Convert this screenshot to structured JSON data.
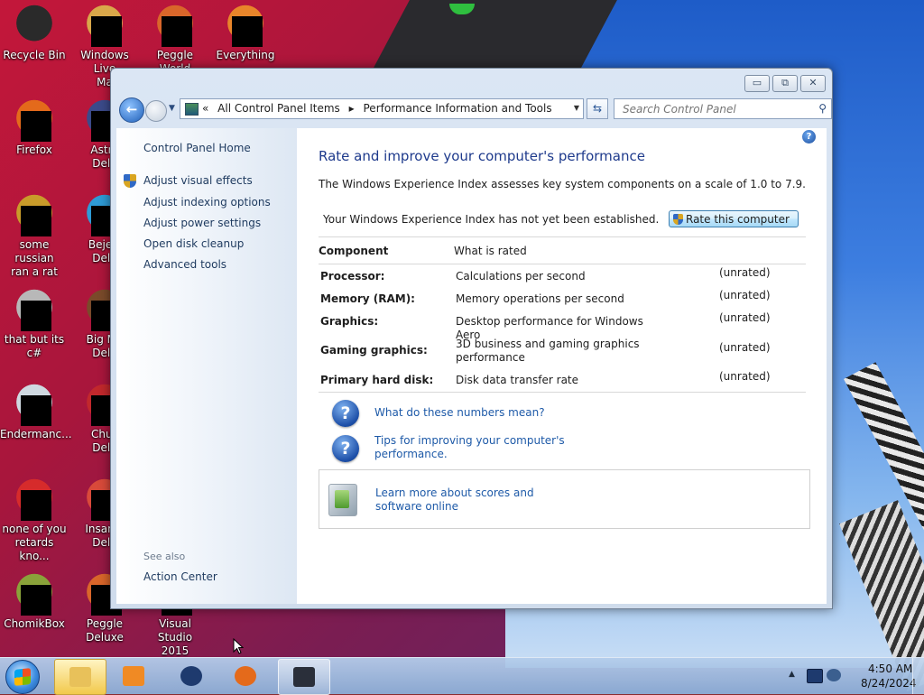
{
  "desktop": {
    "icons": [
      {
        "label": "Recycle Bin",
        "icon": "recycle-bin-icon",
        "color": "#2a2a2a"
      },
      {
        "label": "Windows Live\nMa",
        "icon": "windows-live-icon",
        "color": "#d9a74a"
      },
      {
        "label": "Peggle World",
        "icon": "peggle-world-icon",
        "color": "#d9662a"
      },
      {
        "label": "Everything",
        "icon": "everything-icon",
        "color": "#e8852a"
      },
      {
        "label": "Firefox",
        "icon": "firefox-icon",
        "color": "#e46a1b"
      },
      {
        "label": "Astro\nDelu",
        "icon": "astro-icon",
        "color": "#3b4a8a"
      },
      {
        "label": "some russian\nran a rat",
        "icon": "file-icon",
        "color": "#c99b2a"
      },
      {
        "label": "Bejew\nDelu",
        "icon": "bejeweled-icon",
        "color": "#2e9bd6"
      },
      {
        "label": "that but its c#",
        "icon": "file-icon",
        "color": "#b8b8b8"
      },
      {
        "label": "Big Mo\nDelu",
        "icon": "game-icon",
        "color": "#7a4a2a"
      },
      {
        "label": "Endermanc...",
        "icon": "app-icon",
        "color": "#cfd8e0"
      },
      {
        "label": "Chuz\nDelu",
        "icon": "chuzzle-icon",
        "color": "#c2282c"
      },
      {
        "label": "none of you\nretards kno...",
        "icon": "opera-icon",
        "color": "#d62b2b"
      },
      {
        "label": "Insaniq\nDelu",
        "icon": "game-icon",
        "color": "#d94a3a"
      },
      {
        "label": "ChomikBox",
        "icon": "chomikbox-icon",
        "color": "#8aa23a"
      },
      {
        "label": "Peggle Deluxe",
        "icon": "peggle-deluxe-icon",
        "color": "#d9662a"
      },
      {
        "label": "Visual Studio\n2015",
        "icon": "visual-studio-icon",
        "color": "#7a4fc0"
      }
    ]
  },
  "window": {
    "caption_buttons": {
      "minimize": "▭",
      "maximize": "⧉",
      "close": "✕"
    },
    "address": {
      "prefix": "«",
      "crumbs": [
        "All Control Panel Items",
        "▸",
        "Performance Information and Tools"
      ]
    },
    "search_placeholder": "Search Control Panel",
    "left_pane": {
      "home": "Control Panel Home",
      "links": [
        "Adjust visual effects",
        "Adjust indexing options",
        "Adjust power settings",
        "Open disk cleanup",
        "Advanced tools"
      ],
      "see_also": "See also",
      "action_center": "Action Center"
    },
    "main": {
      "title": "Rate and improve your computer's performance",
      "intro": "The Windows Experience Index assesses key system components on a scale of 1.0 to 7.9.",
      "status": "Your Windows Experience Index has not yet been established.",
      "rate_button": "Rate this computer",
      "table": {
        "headers": [
          "Component",
          "What is rated"
        ],
        "rows": [
          {
            "component": "Processor:",
            "what": "Calculations per second",
            "score": "(unrated)"
          },
          {
            "component": "Memory (RAM):",
            "what": "Memory operations per second",
            "score": "(unrated)"
          },
          {
            "component": "Graphics:",
            "what": "Desktop performance for Windows Aero",
            "score": "(unrated)"
          },
          {
            "component": "Gaming graphics:",
            "what": "3D business and gaming graphics performance",
            "score": "(unrated)"
          },
          {
            "component": "Primary hard disk:",
            "what": "Disk data transfer rate",
            "score": "(unrated)"
          }
        ]
      },
      "links": {
        "what_numbers": "What do these numbers mean?",
        "tips": "Tips for improving your computer's\nperformance.",
        "learn_more": "Learn more about scores and\nsoftware online"
      }
    }
  },
  "taskbar": {
    "buttons": [
      {
        "name": "explorer",
        "icon": "folder-icon",
        "color": "#e8c15a",
        "state": "active"
      },
      {
        "name": "media-player",
        "icon": "media-player-icon",
        "color": "#f08a24",
        "state": "normal"
      },
      {
        "name": "globe",
        "icon": "globe-icon",
        "color": "#1e3a6e",
        "state": "normal"
      },
      {
        "name": "firefox",
        "icon": "firefox-icon",
        "color": "#e46a1b",
        "state": "normal"
      },
      {
        "name": "performance-window",
        "icon": "window-icon",
        "color": "#2a2f3a",
        "state": "open"
      }
    ],
    "clock": {
      "time": "4:50 AM",
      "date": "8/24/2024"
    }
  }
}
